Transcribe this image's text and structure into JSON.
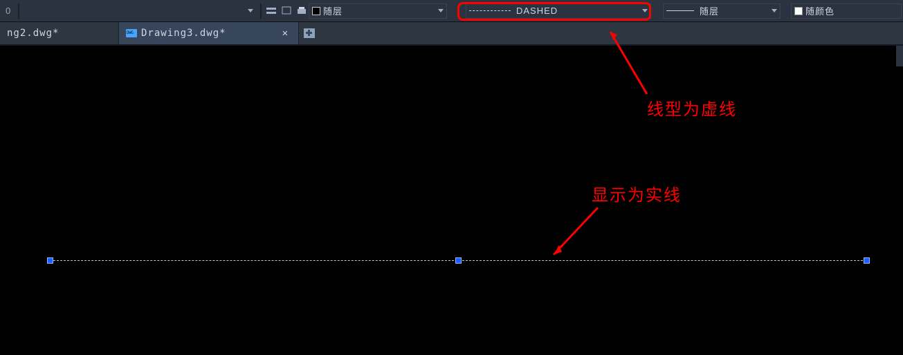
{
  "toolbar": {
    "number_value": "0",
    "layer": {
      "label": "随层"
    },
    "linetype": {
      "label": "DASHED"
    },
    "lineweight": {
      "label": "随层"
    },
    "color": {
      "label": "随颜色"
    }
  },
  "tabs": [
    {
      "label": "ng2.dwg*"
    },
    {
      "label": "Drawing3.dwg*"
    }
  ],
  "annotations": {
    "linetype_note": "线型为虚线",
    "display_note": "显示为实线"
  },
  "highlight": {
    "target": "linetype-dropdown",
    "color": "#ff0000"
  },
  "canvas": {
    "selected_entity": "line",
    "grips": 3
  }
}
